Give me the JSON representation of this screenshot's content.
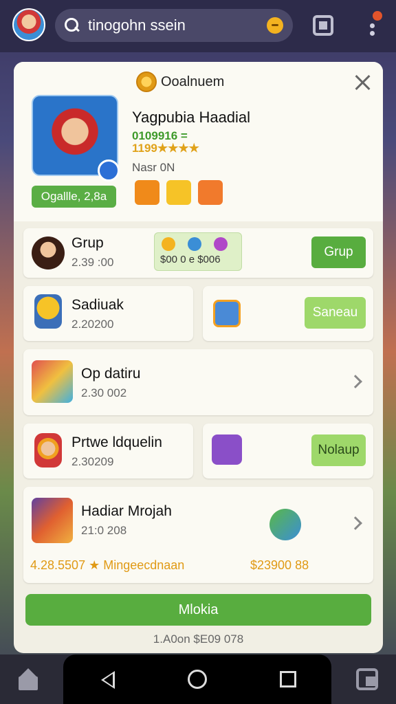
{
  "top": {
    "search_text": "tinogohn ssein"
  },
  "header": {
    "title": "Ooalnuem",
    "hero_name": "Yagpubia Haadial",
    "hero_number": "0109916 =",
    "hero_stars": "1199★★★★",
    "hero_sub": "Nasr 0N",
    "pill": "Ogallle, 2,8a"
  },
  "rows": {
    "grup": {
      "title": "Grup",
      "sub": "2.39 :00",
      "chip_text": "$00 0 e $006",
      "button": "Grup"
    },
    "saduak": {
      "title": "Sadiuak",
      "sub": "2.20200",
      "button": "Saneau"
    },
    "opdatiru": {
      "title": "Op datiru",
      "sub": "2.30 002"
    },
    "private": {
      "title": "Prtwe ldquelin",
      "sub": "2.30209",
      "button": "Nolaup"
    },
    "hadiar": {
      "title": "Hadiar Mrojah",
      "sub": "21:0 208"
    }
  },
  "bottom": {
    "left_text": "4.28.5507 ★ Mingeecdnaan",
    "right_text": "$23900 88"
  },
  "main_button": "Mlokia",
  "footer": "1.A0on $E09 078",
  "colors": {
    "accent_green": "#58ad3f",
    "light_green": "#9ed86a",
    "gold": "#e09a15",
    "card_bg": "#f1efe4"
  },
  "icons": [
    "search-icon",
    "coin-icon",
    "gallery-icon",
    "more-icon",
    "close-icon",
    "chevron-right-icon",
    "home-icon",
    "back-icon",
    "recent-apps-icon",
    "cards-icon"
  ]
}
